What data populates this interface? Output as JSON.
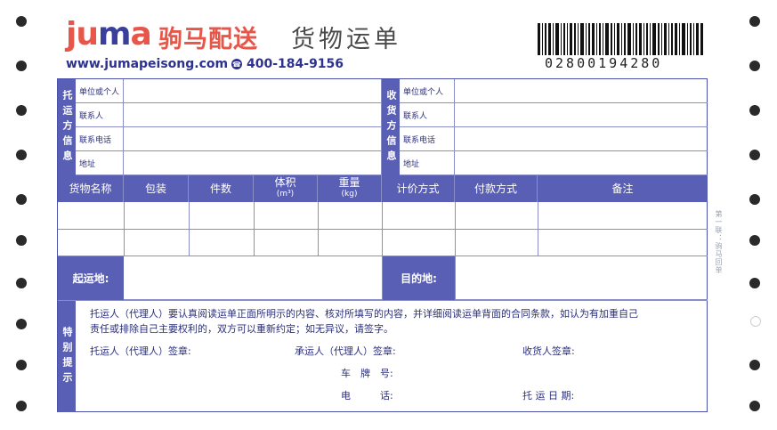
{
  "header": {
    "logo_letters": [
      "j",
      "u",
      "m",
      "a"
    ],
    "brand": "驹马配送",
    "title": "货物运单",
    "website": "www.jumapeisong.com",
    "phone": "400-184-9156",
    "barcode_number": "02800194280"
  },
  "shipper": {
    "section_label": "托运方信息",
    "fields": [
      "单位或个人",
      "联系人",
      "联系电话",
      "地址"
    ]
  },
  "receiver": {
    "section_label": "收货方信息",
    "fields": [
      "单位或个人",
      "联系人",
      "联系电话",
      "地址"
    ]
  },
  "goods": {
    "col_name": "货物名称",
    "col_pack": "包装",
    "col_count": "件数",
    "col_volume": "体积",
    "col_volume_unit": "(m³)",
    "col_weight": "重量",
    "col_weight_unit": "(kg)",
    "col_pricing": "计价方式",
    "col_payment": "付款方式",
    "col_remark": "备注"
  },
  "places": {
    "origin": "起运地:",
    "destination": "目的地:"
  },
  "special": {
    "label": "特别提示",
    "text_line1": "托运人（代理人）要认真阅读运单正面所明示的内容、核对所填写的内容，并详细阅读运单背面的合同条款，如认为有加重自己",
    "text_line2": "责任或排除自己主要权利的，双方可以重新约定；如无异议，请签字。",
    "shipper_sign": "托运人（代理人）签章:",
    "carrier_sign": "承运人（代理人）签章:",
    "receiver_sign": "收货人签章:",
    "plate": "车　牌　号:",
    "tel": "电　　　话:",
    "date": "托 运 日 期:"
  },
  "side_note": "第一联：驹马回单",
  "colors": {
    "brand_red": "#e8564a",
    "brand_blue": "#2d3190",
    "header_fill": "#5a5fb6"
  }
}
